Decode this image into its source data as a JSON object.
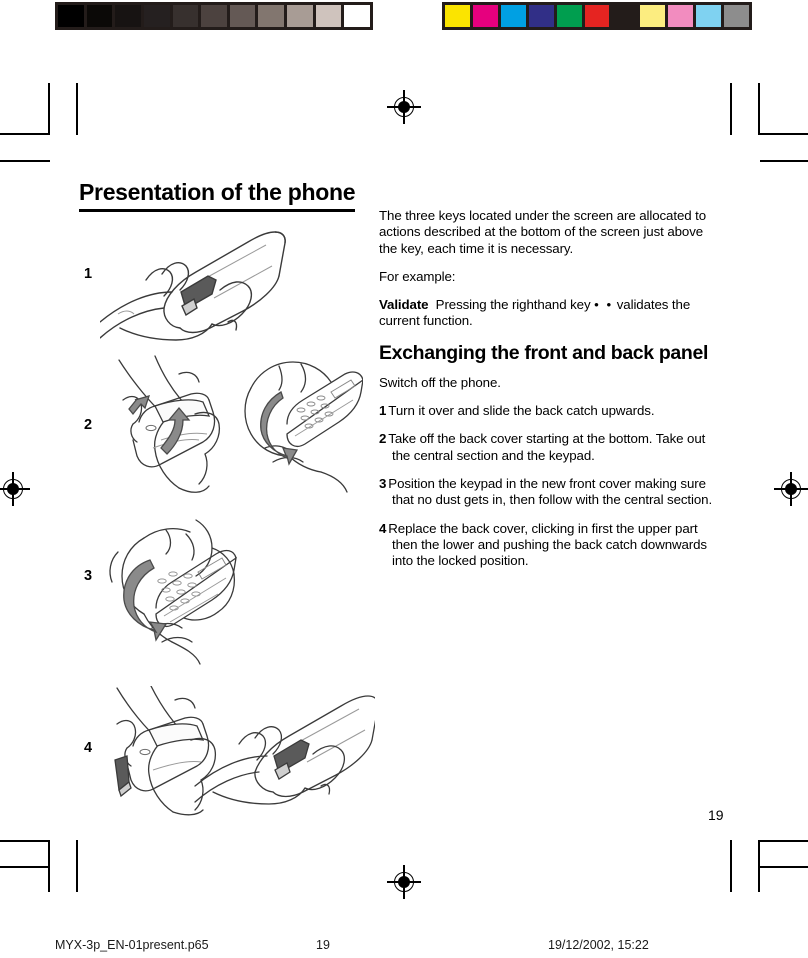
{
  "document": {
    "title": "Presentation of the phone",
    "page_number": "19"
  },
  "body": {
    "intro": "The three keys located under the screen are allocated to actions described at the bottom of the screen just above the key, each time it is necessary.",
    "for_example": "For example:",
    "validate_label": "Validate",
    "validate_text_before": "Pressing the righthand key",
    "validate_key_glyph": "• •",
    "validate_text_after": "validates the current function."
  },
  "section": {
    "heading": "Exchanging the front and back panel",
    "intro": "Switch off the phone.",
    "steps": [
      {
        "num": "1",
        "text": "Turn it over and slide the back catch upwards."
      },
      {
        "num": "2",
        "text": "Take off the back cover starting at the bottom. Take out the central section and the keypad."
      },
      {
        "num": "3",
        "text": "Position the keypad in the new front cover making sure that no dust gets in, then follow with the central section."
      },
      {
        "num": "4",
        "text": "Replace the back cover, clicking in first the  upper part then the lower and pushing the back catch downwards into the locked position."
      }
    ]
  },
  "figures": [
    {
      "label": "1",
      "caption_alt": "Hand holding phone, sliding back catch upwards"
    },
    {
      "label": "2",
      "caption_alt": "Two hands removing back cover and lifting out central section and keypad"
    },
    {
      "label": "3",
      "caption_alt": "Hand positioning keypad into new front cover"
    },
    {
      "label": "4",
      "caption_alt": "Two hands replacing back cover and pushing back catch downwards"
    }
  ],
  "calibration": {
    "grayscale_patches": [
      "#000000",
      "#0b0907",
      "#171312",
      "#252020",
      "#37302e",
      "#4c423f",
      "#645955",
      "#82766f",
      "#a89c95",
      "#cfc3bd",
      "#ffffff"
    ],
    "color_patches": [
      "#fbe400",
      "#e6007e",
      "#00a0e3",
      "#312f87",
      "#009e4f",
      "#e52421",
      "#231c1a",
      "#fced80",
      "#f28cbf",
      "#7fd2f1",
      "#8d8d8d"
    ],
    "bar_background": "#231c1a"
  },
  "footer": {
    "filename": "MYX-3p_EN-01present.p65",
    "page": "19",
    "timestamp": "19/12/2002, 15:22"
  }
}
